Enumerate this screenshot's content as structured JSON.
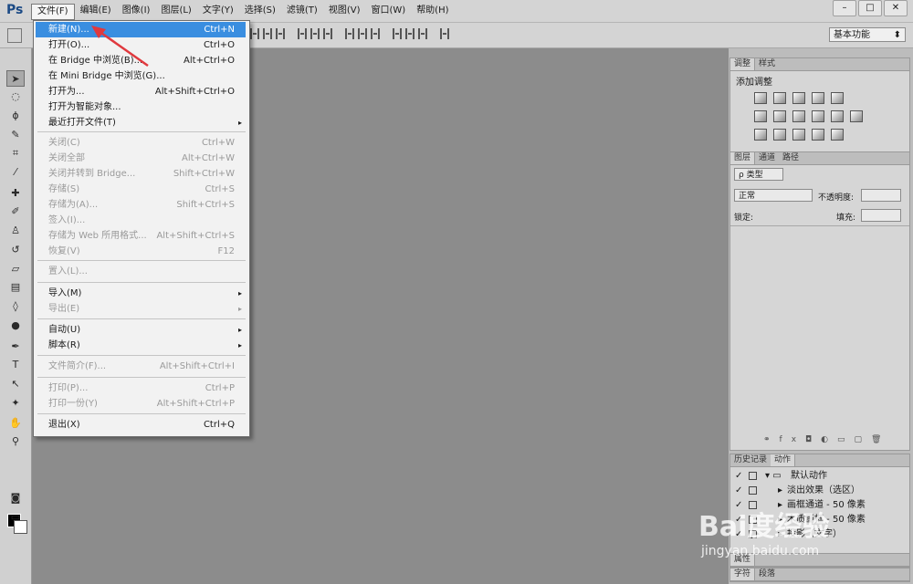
{
  "app": {
    "logo": "Ps"
  },
  "menubar": {
    "items": [
      "文件(F)",
      "编辑(E)",
      "图像(I)",
      "图层(L)",
      "文字(Y)",
      "选择(S)",
      "滤镜(T)",
      "视图(V)",
      "窗口(W)",
      "帮助(H)"
    ]
  },
  "window": {
    "minimize": "–",
    "restore": "□",
    "close": "✕"
  },
  "optionsbar": {
    "workspace": "基本功能"
  },
  "file_menu": {
    "items": [
      {
        "label": "新建(N)...",
        "shortcut": "Ctrl+N",
        "state": "highlighted"
      },
      {
        "label": "打开(O)...",
        "shortcut": "Ctrl+O"
      },
      {
        "label": "在 Bridge 中浏览(B)...",
        "shortcut": "Alt+Ctrl+O"
      },
      {
        "label": "在 Mini Bridge 中浏览(G)...",
        "shortcut": ""
      },
      {
        "label": "打开为...",
        "shortcut": "Alt+Shift+Ctrl+O"
      },
      {
        "label": "打开为智能对象...",
        "shortcut": ""
      },
      {
        "label": "最近打开文件(T)",
        "shortcut": "",
        "submenu": true
      },
      {
        "label": "关闭(C)",
        "shortcut": "Ctrl+W",
        "disabled": true
      },
      {
        "label": "关闭全部",
        "shortcut": "Alt+Ctrl+W",
        "disabled": true
      },
      {
        "label": "关闭并转到 Bridge...",
        "shortcut": "Shift+Ctrl+W",
        "disabled": true
      },
      {
        "label": "存储(S)",
        "shortcut": "Ctrl+S",
        "disabled": true
      },
      {
        "label": "存储为(A)...",
        "shortcut": "Shift+Ctrl+S",
        "disabled": true
      },
      {
        "label": "签入(I)...",
        "shortcut": "",
        "disabled": true
      },
      {
        "label": "存储为 Web 所用格式...",
        "shortcut": "Alt+Shift+Ctrl+S",
        "disabled": true
      },
      {
        "label": "恢复(V)",
        "shortcut": "F12",
        "disabled": true
      },
      {
        "label": "置入(L)...",
        "shortcut": "",
        "disabled": true
      },
      {
        "label": "导入(M)",
        "shortcut": "",
        "submenu": true
      },
      {
        "label": "导出(E)",
        "shortcut": "",
        "submenu": true,
        "disabled": true
      },
      {
        "label": "自动(U)",
        "shortcut": "",
        "submenu": true
      },
      {
        "label": "脚本(R)",
        "shortcut": "",
        "submenu": true
      },
      {
        "label": "文件简介(F)...",
        "shortcut": "Alt+Shift+Ctrl+I",
        "disabled": true
      },
      {
        "label": "打印(P)...",
        "shortcut": "Ctrl+P",
        "disabled": true
      },
      {
        "label": "打印一份(Y)",
        "shortcut": "Alt+Shift+Ctrl+P",
        "disabled": true
      },
      {
        "label": "退出(X)",
        "shortcut": "Ctrl+Q"
      }
    ],
    "submenu_glyph": "▸"
  },
  "adjust_panel": {
    "tabs": [
      "调整",
      "样式"
    ],
    "title": "添加调整"
  },
  "layers_panel": {
    "tabs": [
      "图层",
      "通道",
      "路径"
    ],
    "kind": "ρ 类型",
    "blend": "正常",
    "opacity_label": "不透明度:",
    "lock_label": "锁定:",
    "fill_label": "填充:"
  },
  "actions_panel": {
    "tabs": [
      "历史记录",
      "动作"
    ],
    "rows": [
      "默认动作",
      "淡出效果（选区）",
      "画框通道 - 50 像素",
      "木质画框 - 50 像素",
      "投影（文字）"
    ]
  },
  "bottom_tabs": {
    "row1": [
      "属性"
    ],
    "row2": [
      "字符",
      "段落"
    ]
  },
  "watermark": {
    "logo": "Bai度经验",
    "url": "jingyan.baidu.com"
  },
  "colors": {
    "accent": "#3a8ee0",
    "canvas": "#8c8c8c",
    "arrow": "#e0393e"
  }
}
